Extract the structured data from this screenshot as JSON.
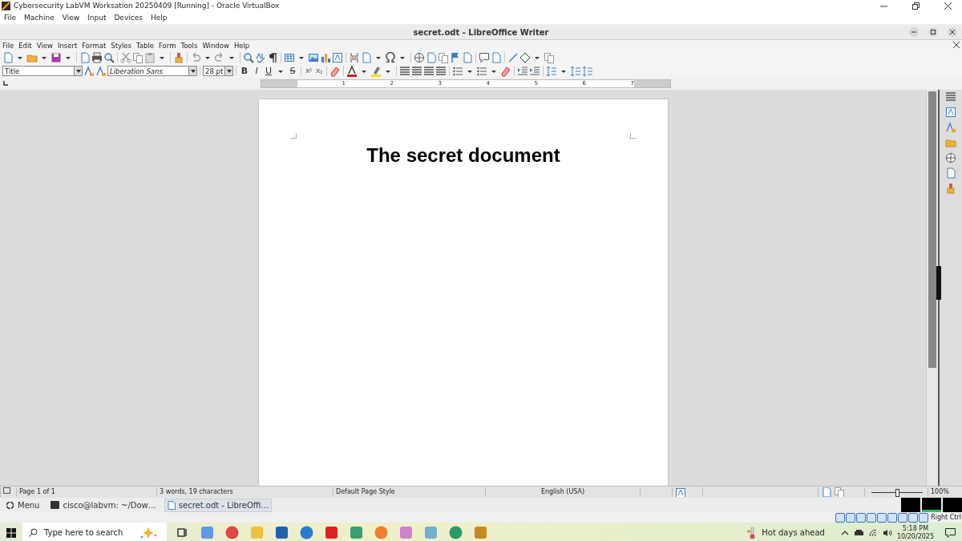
{
  "vm_window": {
    "title": "Cybersecurity LabVM Worksation 20250409 [Running] - Oracle VirtualBox",
    "menu": [
      "File",
      "Machine",
      "View",
      "Input",
      "Devices",
      "Help"
    ]
  },
  "writer": {
    "title": "secret.odt - LibreOffice Writer",
    "menu": [
      "File",
      "Edit",
      "View",
      "Insert",
      "Format",
      "Styles",
      "Table",
      "Form",
      "Tools",
      "Window",
      "Help"
    ],
    "paragraph_style": "Title",
    "font_name": "Liberation Sans",
    "font_size": "28 pt",
    "format_buttons": [
      {
        "label": "B",
        "kind": "bold"
      },
      {
        "label": "I",
        "kind": "italic"
      },
      {
        "label": "U",
        "kind": "underline"
      },
      {
        "label": "S",
        "kind": "strike"
      }
    ],
    "script_buttons": [
      "X²",
      "X₂"
    ],
    "ruler_labels": [
      "1",
      "2",
      "3",
      "4",
      "5",
      "6",
      "7"
    ],
    "document": {
      "heading": "The secret document"
    },
    "status_bar": {
      "page": "Page 1 of 1",
      "word_count": "3 words, 19 characters",
      "page_style": "Default Page Style",
      "language": "English (USA)",
      "zoom": "100%"
    },
    "zoom_slider": {
      "level": 0.5
    }
  },
  "panel": {
    "menu": "Menu",
    "tasks": [
      {
        "label": "cisco@labvm: ~/Dow…",
        "kind": "terminal",
        "selected": false
      },
      {
        "label": "secret.odt - LibreOffi…",
        "kind": "document",
        "selected": true
      }
    ],
    "workspaces": [
      {
        "selected": false
      },
      {
        "selected": true
      },
      {
        "selected": false
      }
    ]
  },
  "vm_status": {
    "host_key": "Right Ctrl"
  },
  "taskbar": {
    "search_placeholder": "Type here to search",
    "weather": "Hot days ahead",
    "time": "5:18 PM",
    "date": "10/20/2025"
  }
}
